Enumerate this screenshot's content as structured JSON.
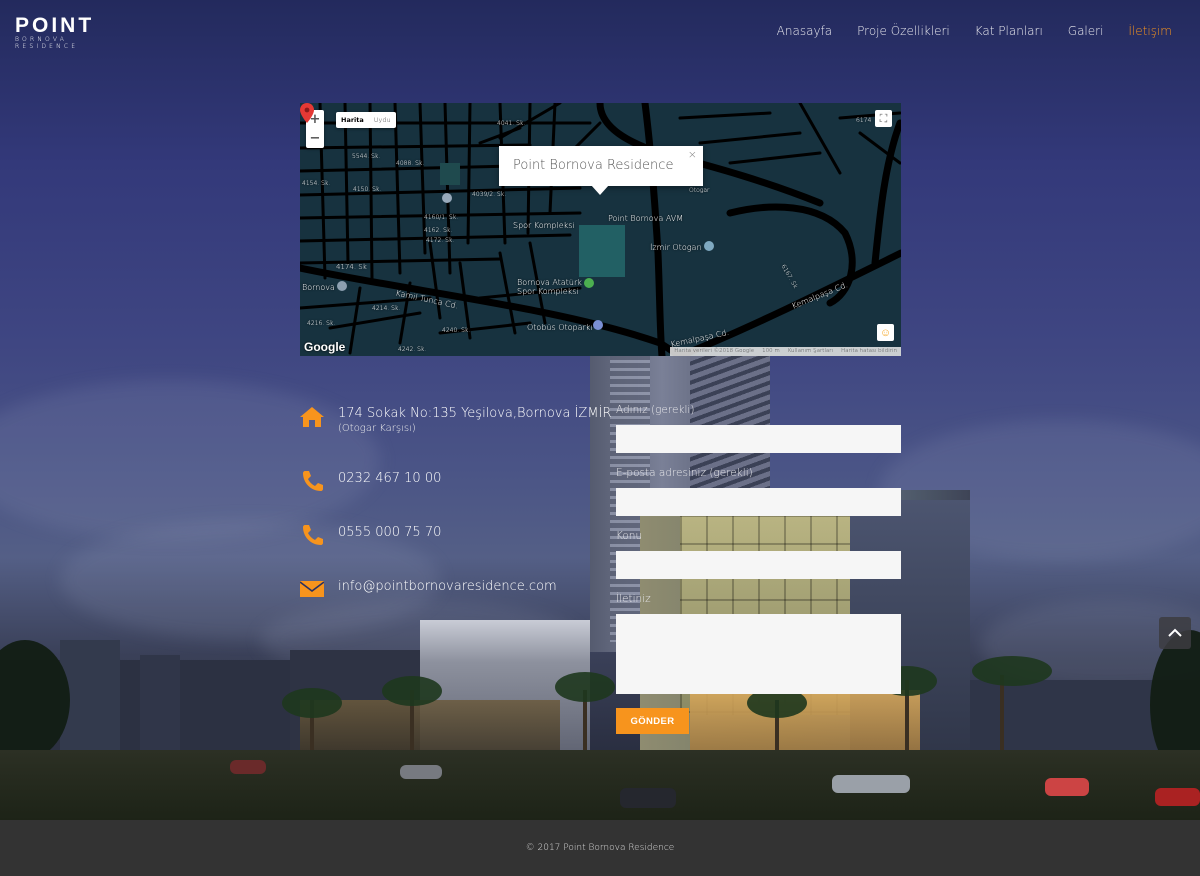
{
  "brand": {
    "name": "POINT",
    "tagline": "BORNOVA RESIDENCE"
  },
  "nav": {
    "items": [
      {
        "label": "Anasayfa"
      },
      {
        "label": "Proje Özellikleri"
      },
      {
        "label": "Kat Planları"
      },
      {
        "label": "Galeri"
      },
      {
        "label": "İletişim",
        "active": true
      }
    ],
    "active_color": "#f7941d"
  },
  "map": {
    "zoom_in": "+",
    "zoom_out": "−",
    "type_options": [
      "Harita",
      "Uydu"
    ],
    "selected_type": "Harita",
    "popup_title": "Point Bornova Residence",
    "popup_close": "×",
    "labels": {
      "point_avm": "Point Bornova AVM",
      "izmir_otogar": "İzmir Otogarı",
      "otogar": "Otogar",
      "ataturk_spor": "Bornova Atatürk",
      "ataturk_spor2": "Spor Kompleksi",
      "otobus_otoparki": "Otobüs Otoparkı",
      "bornova": "Bornova",
      "kamil_tunca": "Kamil Tunca Cd.",
      "kemalpasa_1": "Kemalpaşa Cd.",
      "kemalpasa_2": "Kemalpaşa Cd.",
      "s4174": "4174. Sk",
      "s5544": "5544. Sk.",
      "s4088": "4088. Sk.",
      "s4154": "4154. Sk.",
      "s4150": "4150. Sk.",
      "s4160": "4160/1. Sk.",
      "s4162": "4162. Sk.",
      "s4172": "4172. Sk.",
      "s4214": "4214. Sk.",
      "s4216": "4216. Sk.",
      "s4240": "4240. Sk.",
      "s4242": "4242. Sk.",
      "s4041": "4041. Sk.",
      "s6174": "6174",
      "s6167": "6167. Sk",
      "s4039": "4039/2. Sk."
    },
    "google": "Google",
    "attribution": [
      "Harita verileri ©2018 Google",
      "100 m",
      "Kullanım Şartları",
      "Harita hatası bildirin"
    ],
    "pin_color": "#e53935"
  },
  "contact": {
    "address": "174 Sokak No:135 Yeşilova,Bornova İZMİR",
    "address_note": "(Otogar Karşısı)",
    "phone1": "0232 467 10 00",
    "phone2": "0555 000 75 70",
    "email": "info@pointbornovaresidence.com",
    "icon_color": "#f7941d",
    "icons": [
      "home-icon",
      "phone-icon",
      "phone-icon",
      "mail-icon"
    ]
  },
  "form": {
    "name_label": "Adınız (gerekli)",
    "name_value": "",
    "email_label": "E-posta adresiniz (gerekli)",
    "email_value": "",
    "subject_label": "Konu",
    "subject_value": "",
    "message_label": "İletiniz",
    "message_value": "",
    "submit_label": "GÖNDER"
  },
  "back_to_top": "chevron-up-icon",
  "footer": {
    "copyright": "© 2017 Point Bornova Residence"
  }
}
